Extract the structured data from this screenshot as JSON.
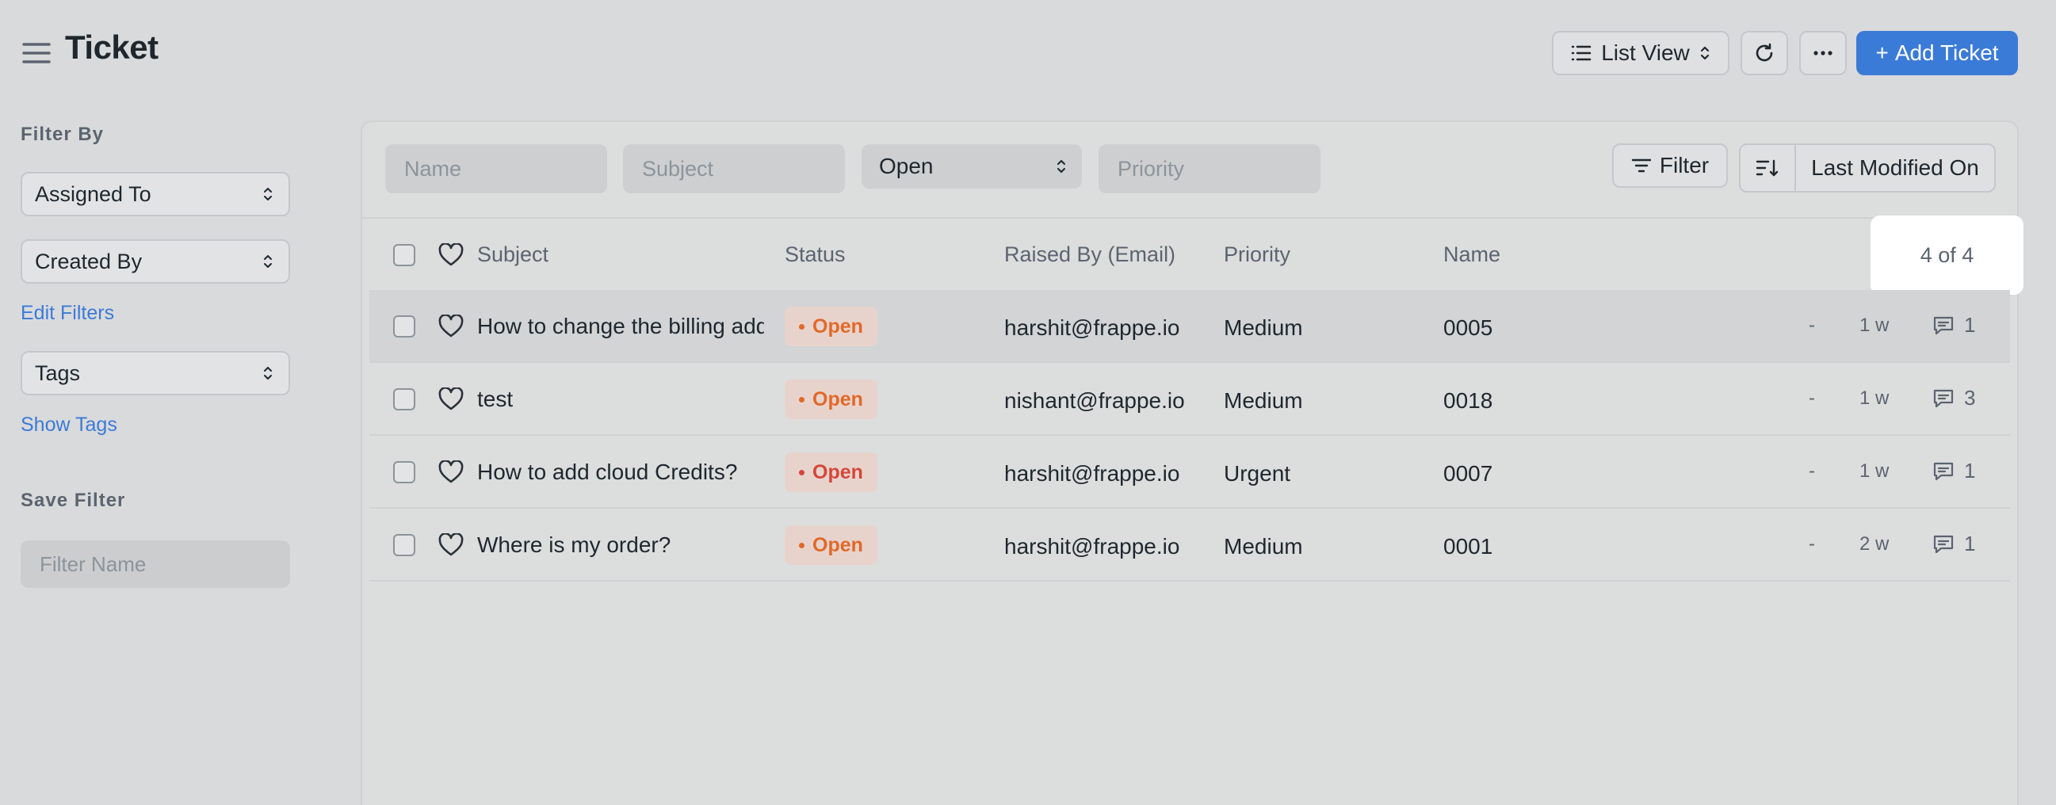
{
  "header": {
    "title": "Ticket",
    "view_label": "List View",
    "add_label": "Add Ticket",
    "add_prefix": "+"
  },
  "sidebar": {
    "filter_heading": "Filter By",
    "assigned_to": "Assigned To",
    "created_by": "Created By",
    "edit_filters": "Edit Filters",
    "tags": "Tags",
    "show_tags": "Show Tags",
    "save_heading": "Save Filter",
    "filter_name_placeholder": "Filter Name"
  },
  "filters": {
    "name_placeholder": "Name",
    "subject_placeholder": "Subject",
    "status_value": "Open",
    "priority_placeholder": "Priority",
    "filter_label": "Filter",
    "sort_label": "Last Modified On"
  },
  "table": {
    "columns": [
      "Subject",
      "Status",
      "Raised By (Email)",
      "Priority",
      "Name"
    ],
    "count": "4 of 4",
    "rows": [
      {
        "subject": "How to change the billing address?",
        "status": "Open",
        "email": "harshit@frappe.io",
        "priority": "Medium",
        "name": "0005",
        "assigned": "-",
        "age": "1 w",
        "comments": "1"
      },
      {
        "subject": "test",
        "status": "Open",
        "email": "nishant@frappe.io",
        "priority": "Medium",
        "name": "0018",
        "assigned": "-",
        "age": "1 w",
        "comments": "3"
      },
      {
        "subject": "How to add cloud Credits?",
        "status": "Open",
        "email": "harshit@frappe.io",
        "priority": "Urgent",
        "name": "0007",
        "assigned": "-",
        "age": "1 w",
        "comments": "1"
      },
      {
        "subject": "Where is my order?",
        "status": "Open",
        "email": "harshit@frappe.io",
        "priority": "Medium",
        "name": "0001",
        "assigned": "-",
        "age": "2 w",
        "comments": "1"
      }
    ]
  },
  "colors": {
    "accent": "#3b7bd8",
    "status_open": "#e0692a",
    "status_open_urgent": "#d4473a",
    "badge_bg": "#e8d3cc"
  }
}
